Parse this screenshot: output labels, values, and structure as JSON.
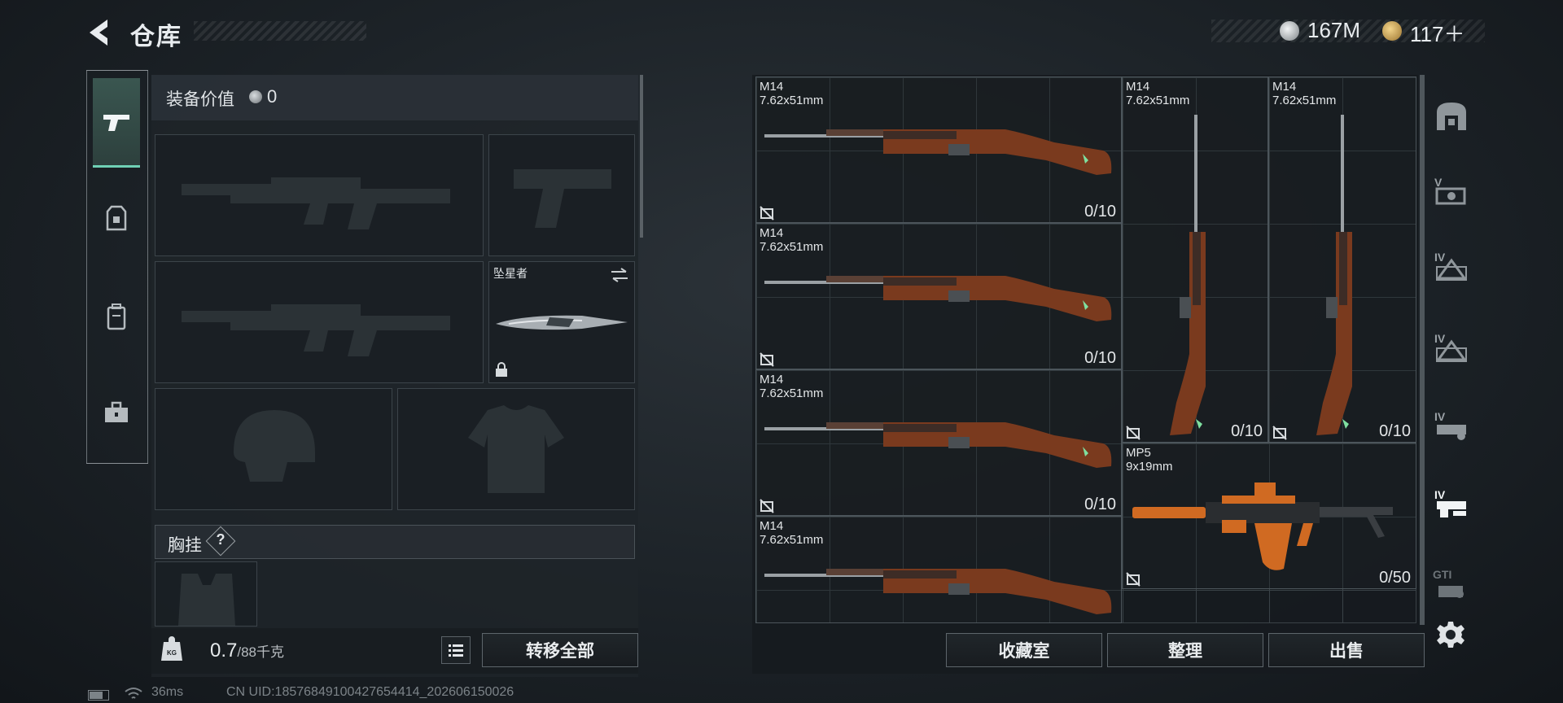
{
  "header": {
    "title": "仓库",
    "currency_silver": "167M",
    "currency_gold": "117＋"
  },
  "equipment": {
    "value_label": "装备价值",
    "value": "0",
    "melee_name": "坠星者",
    "chest_rig_label": "胸挂",
    "help_glyph": "?"
  },
  "inventory": {
    "weight_current": "0.7",
    "weight_max": "/88千克",
    "transfer_all_label": "转移全部"
  },
  "storage": {
    "items": [
      {
        "name": "M14",
        "caliber": "7.62x51mm",
        "count": "0/10"
      },
      {
        "name": "M14",
        "caliber": "7.62x51mm",
        "count": "0/10"
      },
      {
        "name": "M14",
        "caliber": "7.62x51mm",
        "count": "0/10"
      },
      {
        "name": "M14",
        "caliber": "7.62x51mm",
        "count": ""
      },
      {
        "name": "M14",
        "caliber": "7.62x51mm",
        "count": "0/10"
      },
      {
        "name": "M14",
        "caliber": "7.62x51mm",
        "count": "0/10"
      },
      {
        "name": "MP5",
        "caliber": "9x19mm",
        "count": "0/50"
      }
    ],
    "buttons": {
      "collection": "收藏室",
      "sort": "整理",
      "sell": "出售"
    }
  },
  "categories": {
    "items": [
      {
        "label": ""
      },
      {
        "label": "V"
      },
      {
        "label": "IV"
      },
      {
        "label": "IV"
      },
      {
        "label": "IV"
      },
      {
        "label": "IV"
      },
      {
        "label": "GTI"
      }
    ]
  },
  "status": {
    "ping": "36ms",
    "uid": "CN UID:18576849100427654414_202606150026"
  },
  "colors": {
    "accent_teal": "#6fd0b5",
    "wood": "#7a3a1e",
    "copper": "#d06a22"
  }
}
